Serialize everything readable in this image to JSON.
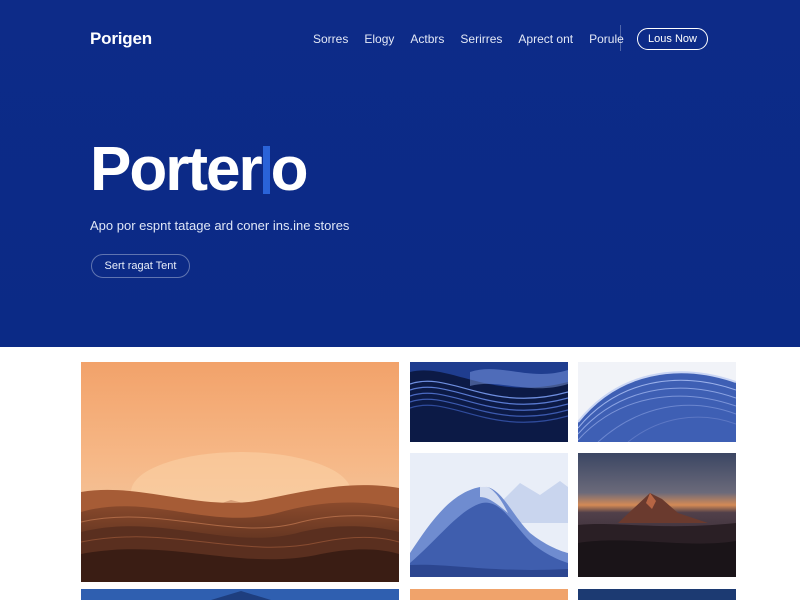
{
  "header": {
    "logo": "Porigen",
    "nav": [
      "Sorres",
      "Elogy",
      "Actbrs",
      "Serirres",
      "Aprect ont",
      "Porule"
    ],
    "cta_label": "Lous Now"
  },
  "hero": {
    "title_before": "Porter",
    "title_after": "o",
    "subtitle": "Apo por espnt tatage ard coner ins.ine stores",
    "button_label": "Sert ragat Tent"
  },
  "gallery": {
    "tiles": [
      {
        "subject": "desert-dunes-sunset"
      },
      {
        "subject": "blue-abstract-waves"
      },
      {
        "subject": "blue-abstract-ridges"
      },
      {
        "subject": "blue-snowy-mountains"
      },
      {
        "subject": "dark-mountain-dusk"
      },
      {
        "subject": "blue-mountain-partial"
      },
      {
        "subject": "orange-sky-partial"
      },
      {
        "subject": "dark-blue-partial"
      }
    ]
  },
  "colors": {
    "hero_bg": "#0c2a86",
    "accent": "#2a63d8",
    "text_light": "#ffffff"
  }
}
